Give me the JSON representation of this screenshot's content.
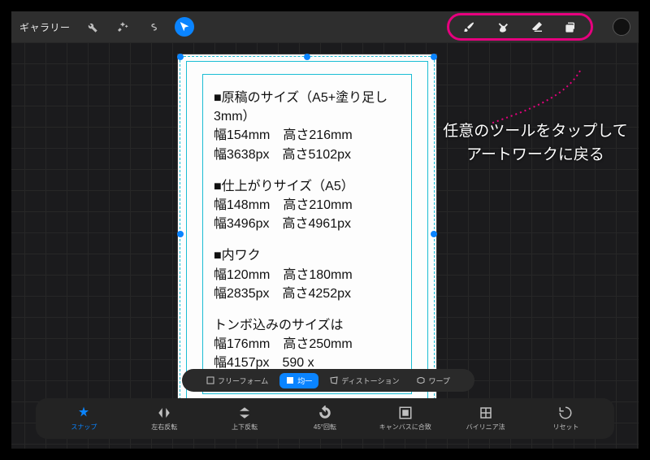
{
  "topbar": {
    "gallery_label": "ギャラリー",
    "tools": {
      "wrench": "wrench-icon",
      "wand": "wand-icon",
      "lasso": "lasso-icon",
      "pointer": "pointer-icon"
    }
  },
  "right_tools": {
    "brush": "brush-icon",
    "smudge": "smudge-icon",
    "eraser": "eraser-icon",
    "layers": "layers-icon"
  },
  "annotation": {
    "line1": "任意のツールをタップして",
    "line2": "アートワークに戻る"
  },
  "document": {
    "section1": {
      "title": "■原稿のサイズ（A5+塗り足し3mm）",
      "line1": "幅154mm　高さ216mm",
      "line2": "幅3638px　高さ5102px"
    },
    "section2": {
      "title": "■仕上がりサイズ（A5）",
      "line1": "幅148mm　高さ210mm",
      "line2": "幅3496px　高さ4961px"
    },
    "section3": {
      "title": "■内ワク",
      "line1": "幅120mm　高さ180mm",
      "line2": "幅2835px　高さ4252px"
    },
    "section4": {
      "title": "トンボ込みのサイズは",
      "line1": "幅176mm　高さ250mm",
      "line2": "幅4157px　590     x"
    }
  },
  "transform_modes": {
    "freeform": "フリーフォーム",
    "uniform": "均一",
    "distort": "ディストーション",
    "warp": "ワープ"
  },
  "actions": {
    "snap": "スナップ",
    "flip_h": "左右反転",
    "flip_v": "上下反転",
    "rotate": "45°回転",
    "fit": "キャンバスに合致",
    "bilinear": "バイリニア法",
    "reset": "リセット"
  },
  "colors": {
    "accent": "#0a84ff",
    "callout": "#e6007e"
  }
}
